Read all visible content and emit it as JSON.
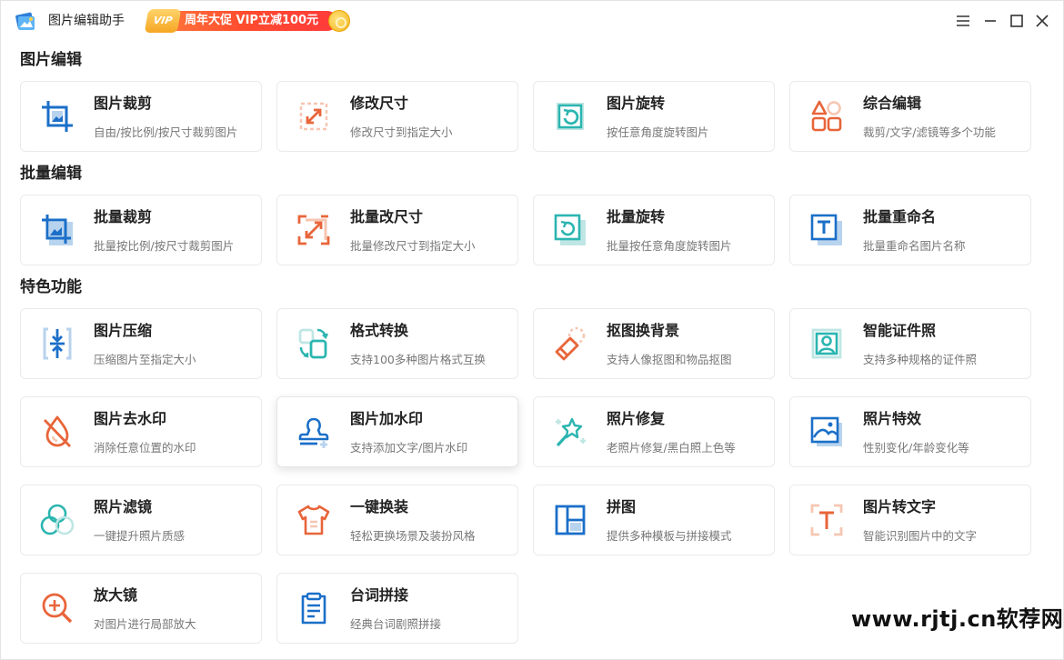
{
  "titlebar": {
    "app_title": "图片编辑助手",
    "promo_vip": "VIP",
    "promo_text": "周年大促 VIP立减100元"
  },
  "colors": {
    "blue": "#1b6fc8",
    "teal": "#2bb5b0",
    "orange": "#e8653a",
    "light_blue": "#b8d3ee",
    "light_teal": "#bfe6e4",
    "light_orange": "#f6c6b2"
  },
  "sections": [
    {
      "title": "图片编辑"
    },
    {
      "title": "批量编辑"
    },
    {
      "title": "特色功能"
    }
  ],
  "cards": {
    "crop": {
      "title": "图片裁剪",
      "desc": "自由/按比例/按尺寸裁剪图片",
      "icon": "crop-icon"
    },
    "resize": {
      "title": "修改尺寸",
      "desc": "修改尺寸到指定大小",
      "icon": "resize-icon"
    },
    "rotate": {
      "title": "图片旋转",
      "desc": "按任意角度旋转图片",
      "icon": "rotate-icon"
    },
    "edit": {
      "title": "综合编辑",
      "desc": "裁剪/文字/滤镜等多个功能",
      "icon": "shapes-icon"
    },
    "batch_crop": {
      "title": "批量裁剪",
      "desc": "批量按比例/按尺寸裁剪图片",
      "icon": "batch-crop-icon"
    },
    "batch_resize": {
      "title": "批量改尺寸",
      "desc": "批量修改尺寸到指定大小",
      "icon": "batch-resize-icon"
    },
    "batch_rotate": {
      "title": "批量旋转",
      "desc": "批量按任意角度旋转图片",
      "icon": "batch-rotate-icon"
    },
    "batch_rename": {
      "title": "批量重命名",
      "desc": "批量重命名图片名称",
      "icon": "rename-icon"
    },
    "compress": {
      "title": "图片压缩",
      "desc": "压缩图片至指定大小",
      "icon": "compress-icon"
    },
    "convert": {
      "title": "格式转换",
      "desc": "支持100多种图片格式互换",
      "icon": "convert-icon"
    },
    "cutout": {
      "title": "抠图换背景",
      "desc": "支持人像抠图和物品抠图",
      "icon": "eraser-icon"
    },
    "id_photo": {
      "title": "智能证件照",
      "desc": "支持多种规格的证件照",
      "icon": "id-photo-icon"
    },
    "remove_wm": {
      "title": "图片去水印",
      "desc": "消除任意位置的水印",
      "icon": "no-drop-icon"
    },
    "add_wm": {
      "title": "图片加水印",
      "desc": "支持添加文字/图片水印",
      "icon": "stamp-icon"
    },
    "repair": {
      "title": "照片修复",
      "desc": "老照片修复/黑白照上色等",
      "icon": "magic-wand-icon"
    },
    "effects": {
      "title": "照片特效",
      "desc": "性别变化/年龄变化等",
      "icon": "image-effect-icon"
    },
    "filter": {
      "title": "照片滤镜",
      "desc": "一键提升照片质感",
      "icon": "filter-icon"
    },
    "outfit": {
      "title": "一键换装",
      "desc": "轻松更换场景及装扮风格",
      "icon": "tshirt-icon"
    },
    "collage": {
      "title": "拼图",
      "desc": "提供多种模板与拼接模式",
      "icon": "collage-icon"
    },
    "ocr": {
      "title": "图片转文字",
      "desc": "智能识别图片中的文字",
      "icon": "ocr-icon"
    },
    "magnify": {
      "title": "放大镜",
      "desc": "对图片进行局部放大",
      "icon": "magnifier-icon"
    },
    "subtitle": {
      "title": "台词拼接",
      "desc": "经典台词剧照拼接",
      "icon": "clipboard-icon"
    }
  },
  "watermark": "www.rjtj.cn软荐网"
}
